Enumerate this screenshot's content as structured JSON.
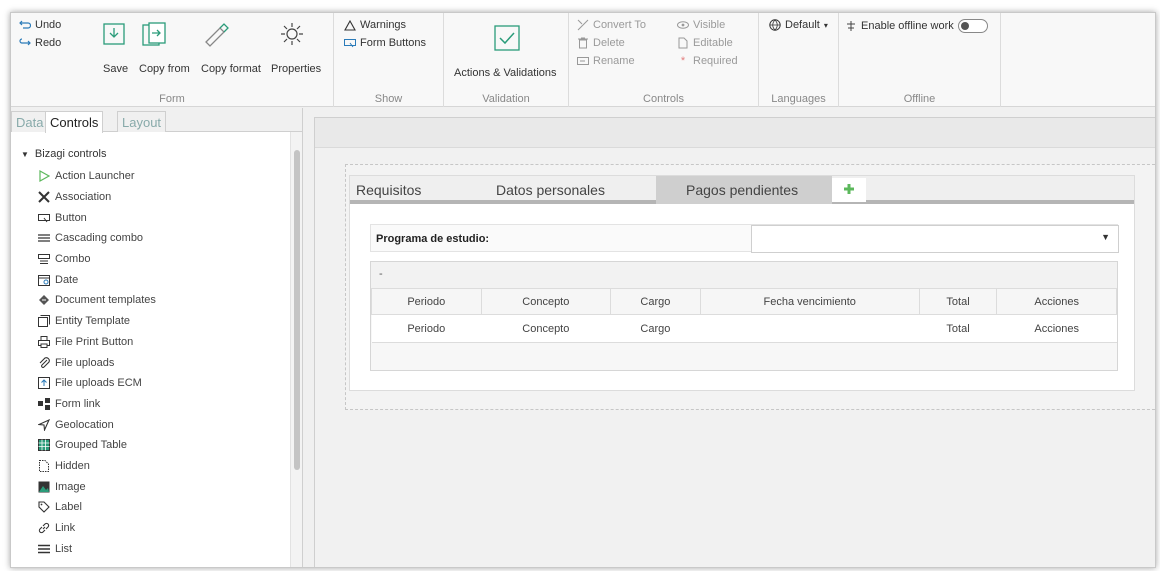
{
  "ribbon": {
    "form_group": {
      "undo": "Undo",
      "redo": "Redo",
      "save": "Save",
      "copy_from": "Copy from",
      "copy_format": "Copy format",
      "properties": "Properties",
      "label": "Form"
    },
    "show_group": {
      "warnings": "Warnings",
      "form_buttons": "Form Buttons",
      "label": "Show"
    },
    "validation_group": {
      "actions_validations": "Actions & Validations",
      "label": "Validation"
    },
    "controls_group": {
      "convert_to": "Convert To",
      "delete": "Delete",
      "rename": "Rename",
      "visible": "Visible",
      "editable": "Editable",
      "required": "Required",
      "label": "Controls"
    },
    "languages_group": {
      "default": "Default",
      "label": "Languages"
    },
    "offline_group": {
      "enable_offline": "Enable offline work",
      "label": "Offline"
    }
  },
  "left_panel": {
    "tabs": [
      "Data",
      "Controls",
      "Layout"
    ],
    "active_tab": "Controls",
    "tree_root": "Bizagi controls",
    "items": [
      {
        "label": "Action Launcher",
        "icon": "play-icon"
      },
      {
        "label": "Association",
        "icon": "association-icon"
      },
      {
        "label": "Button",
        "icon": "button-icon"
      },
      {
        "label": "Cascading combo",
        "icon": "cascading-combo-icon"
      },
      {
        "label": "Combo",
        "icon": "combo-icon"
      },
      {
        "label": "Date",
        "icon": "calendar-icon"
      },
      {
        "label": "Document templates",
        "icon": "document-template-icon"
      },
      {
        "label": "Entity Template",
        "icon": "entity-template-icon"
      },
      {
        "label": "File Print Button",
        "icon": "printer-icon"
      },
      {
        "label": "File uploads",
        "icon": "paperclip-icon"
      },
      {
        "label": "File uploads ECM",
        "icon": "upload-icon"
      },
      {
        "label": "Form link",
        "icon": "form-link-icon"
      },
      {
        "label": "Geolocation",
        "icon": "location-arrow-icon"
      },
      {
        "label": "Grouped Table",
        "icon": "table-icon"
      },
      {
        "label": "Hidden",
        "icon": "hidden-icon"
      },
      {
        "label": "Image",
        "icon": "image-icon"
      },
      {
        "label": "Label",
        "icon": "tag-icon"
      },
      {
        "label": "Link",
        "icon": "link-icon"
      },
      {
        "label": "List",
        "icon": "list-icon"
      }
    ]
  },
  "form": {
    "tabs": [
      "Requisitos",
      "Datos personales",
      "Pagos pendientes"
    ],
    "active_tab": "Pagos pendientes",
    "field_label": "Programa de estudio:",
    "grid_caption": "-",
    "columns": [
      "Periodo",
      "Concepto",
      "Cargo",
      "Fecha vencimiento",
      "Total",
      "Acciones"
    ],
    "row": [
      "Periodo",
      "Concepto",
      "Cargo",
      "",
      "Total",
      "Acciones"
    ]
  },
  "colors": {
    "accent_green": "#5cb85c",
    "tab_active_bg": "#cfcfcf"
  }
}
